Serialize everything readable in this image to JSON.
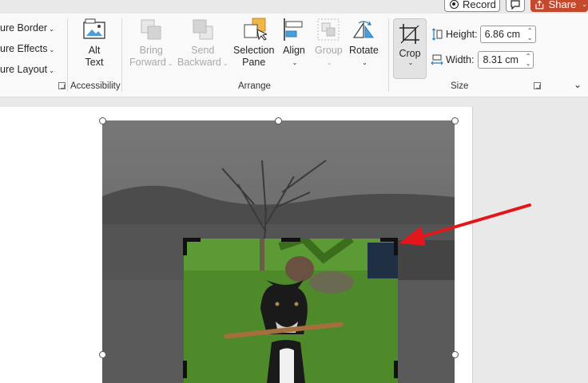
{
  "topbar": {
    "record_label": "Record",
    "share_label": "Share"
  },
  "ribbon": {
    "picture_styles": {
      "items": [
        "ure Border",
        "ure Effects",
        "ure Layout"
      ]
    },
    "accessibility": {
      "alt_text_line1": "Alt",
      "alt_text_line2": "Text",
      "group_label": "Accessibility"
    },
    "arrange": {
      "bring_forward_line1": "Bring",
      "bring_forward_line2": "Forward",
      "send_backward_line1": "Send",
      "send_backward_line2": "Backward",
      "selection_pane_line1": "Selection",
      "selection_pane_line2": "Pane",
      "align_label": "Align",
      "group_label_btn": "Group",
      "rotate_label": "Rotate",
      "group_label": "Arrange"
    },
    "size": {
      "crop_label": "Crop",
      "height_label": "Height:",
      "height_value": "6.86 cm",
      "width_label": "Width:",
      "width_value": "8.31 cm",
      "group_label": "Size"
    }
  },
  "colors": {
    "share_bg": "#c4492c",
    "annotation_arrow": "#e3161c",
    "grass": "#4f8a2a"
  }
}
